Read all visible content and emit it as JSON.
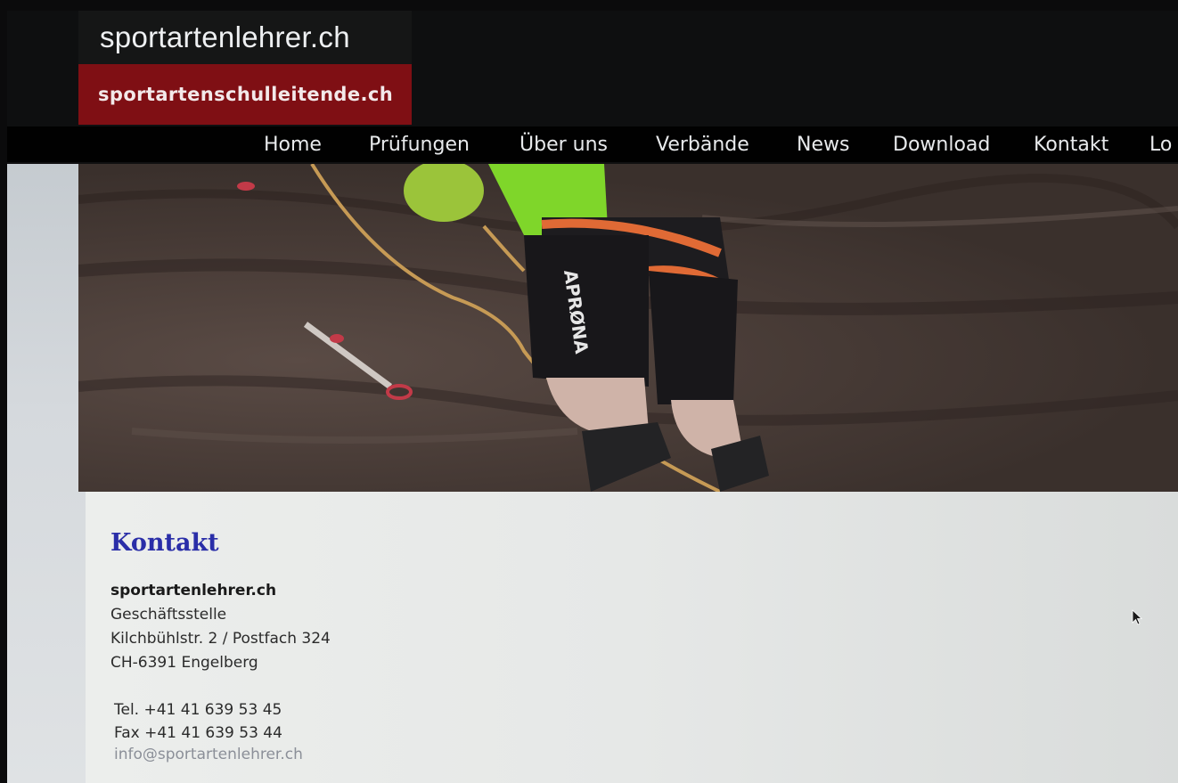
{
  "header": {
    "site_title": "sportartenlehrer.ch",
    "sub_title": "sportartenschulleitende.ch"
  },
  "nav": {
    "items": [
      "Home",
      "Prüfungen",
      "Über uns",
      "Verbände",
      "News",
      "Download",
      "Kontakt",
      "Lo"
    ]
  },
  "hero": {
    "shorts_text": "APRØNA"
  },
  "content": {
    "title": "Kontakt",
    "org_name": "sportartenlehrer.ch",
    "address": [
      "Geschäftsstelle",
      "Kilchbühlstr. 2 / Postfach 324",
      "CH-6391 Engelberg"
    ],
    "phone": "Tel. +41 41 639 53 45",
    "fax": "Fax +41 41 639 53 44",
    "email": "info@sportartenlehrer.ch"
  },
  "colors": {
    "brand_red": "#7f0f14",
    "heading_blue": "#2a2ea8",
    "nav_bg": "#000000"
  }
}
